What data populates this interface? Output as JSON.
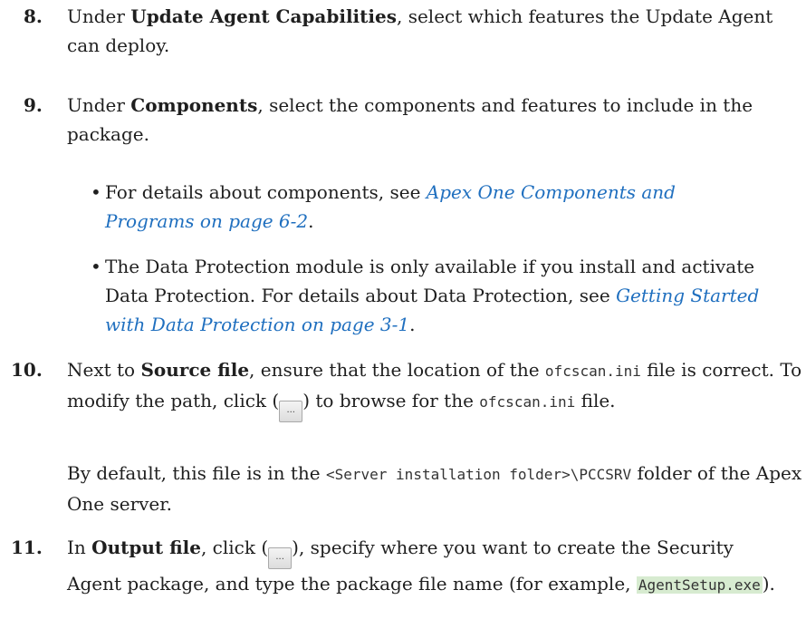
{
  "steps": {
    "s8": {
      "num": "8.",
      "pre": "Under ",
      "bold": "Update Agent Capabilities",
      "post": ", select which features the Update Agent can deploy."
    },
    "s9": {
      "num": "9.",
      "pre": "Under ",
      "bold": "Components",
      "post": ", select the components and features to include in the package.",
      "bullets": [
        {
          "pre": "For details about components, see ",
          "link": "Apex One Components and Programs on page 6-2",
          "post": "."
        },
        {
          "pre": "The Data Protection module is only available if you install and activate Data Protection. For details about Data Protection, see ",
          "link": "Getting Started with Data Protection on page 3-1",
          "post": "."
        }
      ]
    },
    "s10": {
      "num": "10.",
      "pre": "Next to ",
      "bold": "Source file",
      "mid1": ", ensure that the location of the ",
      "code1": "ofcscan.ini",
      "mid2": " file is correct. To modify the path, click (",
      "button": "...",
      "mid3": ") to browse for the ",
      "code2": "ofcscan.ini",
      "post": " file.",
      "para_pre": "By default, this file is in the ",
      "para_code": "<Server installation folder>\\PCCSRV",
      "para_post": " folder of the Apex One server."
    },
    "s11": {
      "num": "11.",
      "pre": "In ",
      "bold": "Output file",
      "mid1": ", click (",
      "button": "...",
      "mid2": "), specify where you want to create the Security Agent package, and type the package file name (for example, ",
      "code": "AgentSetup.exe",
      "post": ")."
    }
  }
}
